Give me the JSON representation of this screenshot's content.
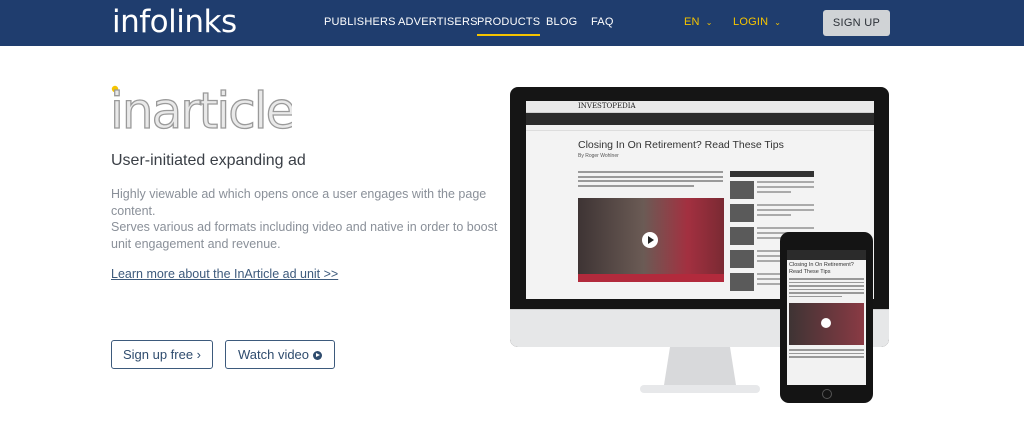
{
  "header": {
    "logo": "infolinks",
    "nav": [
      "PUBLISHERS",
      "ADVERTISERS",
      "PRODUCTS",
      "BLOG",
      "FAQ"
    ],
    "active": "PRODUCTS",
    "lang": "EN",
    "login": "LOGIN",
    "signup": "SIGN UP"
  },
  "hero": {
    "product_logo": "inarticle",
    "subtitle": "User-initiated expanding ad",
    "description_1": "Highly viewable ad which opens once a user engages with the page content.",
    "description_2": "Serves various ad formats including video and native in order to boost unit engagement and revenue.",
    "learn_more": "Learn more about the InArticle ad unit >>",
    "signup_button": "Sign up free ›",
    "watch_button": "Watch video"
  },
  "device_preview": {
    "site": "INVESTOPEDIA",
    "article_title": "Closing In On Retirement? Read These Tips",
    "byline": "By Roger Wohlner",
    "phone_title": "Closing In On Retirement? Read These Tips"
  },
  "colors": {
    "header_bg": "#1f3d6e",
    "accent": "#f5c400",
    "button_border": "#3d5a7c"
  }
}
